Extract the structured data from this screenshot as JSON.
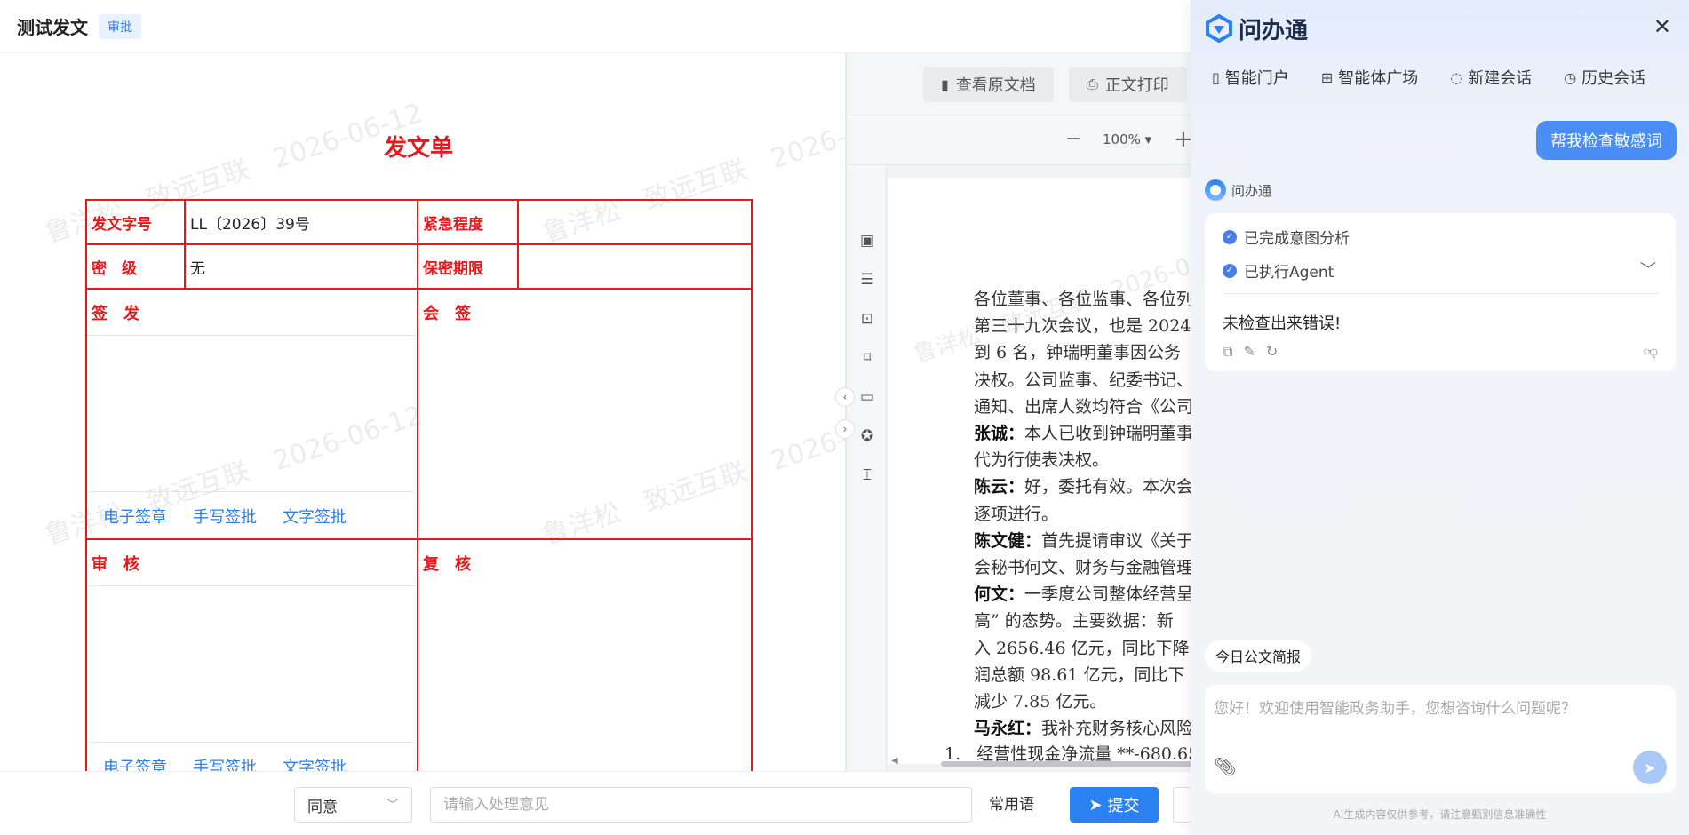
{
  "header": {
    "title": "测试发文",
    "badge": "审批"
  },
  "form": {
    "title": "发文单",
    "doc_number_label": "发文字号",
    "doc_number_value": "LL〔2026〕39号",
    "urgency_label": "紧急程度",
    "urgency_value": "",
    "secret_label": "密　级",
    "secret_value": "无",
    "secret_period_label": "保密期限",
    "secret_period_value": "",
    "sign_label": "签　发",
    "countersign_label": "会　签",
    "review_label": "审　核",
    "recheck_label": "复　核",
    "sign_actions": [
      "电子签章",
      "手写签批",
      "文字签批"
    ],
    "watermark_name": "鲁洋松",
    "watermark_company": "致远互联",
    "watermark_date": "2026-06-12"
  },
  "doc_viewer": {
    "view_original_label": "查看原文档",
    "print_label": "正文打印",
    "zoom": "100%",
    "paragraphs": [
      "各位董事、各位监事、各位列",
      "第三十九次会议，也是 2024",
      "到 6 名，钟瑞明董事因公务",
      "决权。公司监事、纪委书记、",
      "通知、出席人数均符合《公司"
    ],
    "speeches": [
      {
        "speaker": "张诚：",
        "lines": [
          "本人已收到钟瑞明董事",
          "代为行使表决权。"
        ]
      },
      {
        "speaker": "陈云：",
        "lines": [
          "好，委托有效。本次会",
          "逐项进行。"
        ]
      },
      {
        "speaker": "陈文健：",
        "lines": [
          "首先提请审议《关于",
          "会秘书何文、财务与金融管理"
        ]
      },
      {
        "speaker": "何文：",
        "lines": [
          "一季度公司整体经营呈",
          "高” 的态势。主要数据：新",
          "入 2656.46 亿元，同比下降",
          "润总额 98.61 亿元，同比下",
          "减少 7.85 亿元。"
        ]
      },
      {
        "speaker": "马永红：",
        "lines": [
          "我补充财务核心风险"
        ]
      }
    ],
    "list_item_number": "1.",
    "list_item_text": "经营性现金净流量 **-680.65"
  },
  "bottom": {
    "opinion_select": "同意",
    "opinion_placeholder": "请输入处理意见",
    "common_phrases": "常用语",
    "submit": "提交"
  },
  "ai": {
    "brand": "问办通",
    "nav": [
      "智能门户",
      "智能体广场",
      "新建会话",
      "历史会话"
    ],
    "user_message": "帮我检查敏感词",
    "bot_name": "问办通",
    "steps": [
      "已完成意图分析",
      "已执行Agent"
    ],
    "answer": "未检查出来错误!",
    "quick_chip": "今日公文简报",
    "input_placeholder": "您好！欢迎使用智能政务助手，您想咨询什么问题呢？",
    "disclaimer": "AI生成内容仅供参考，请注意甄别信息准确性",
    "accent_color": "#4a8ef5"
  }
}
